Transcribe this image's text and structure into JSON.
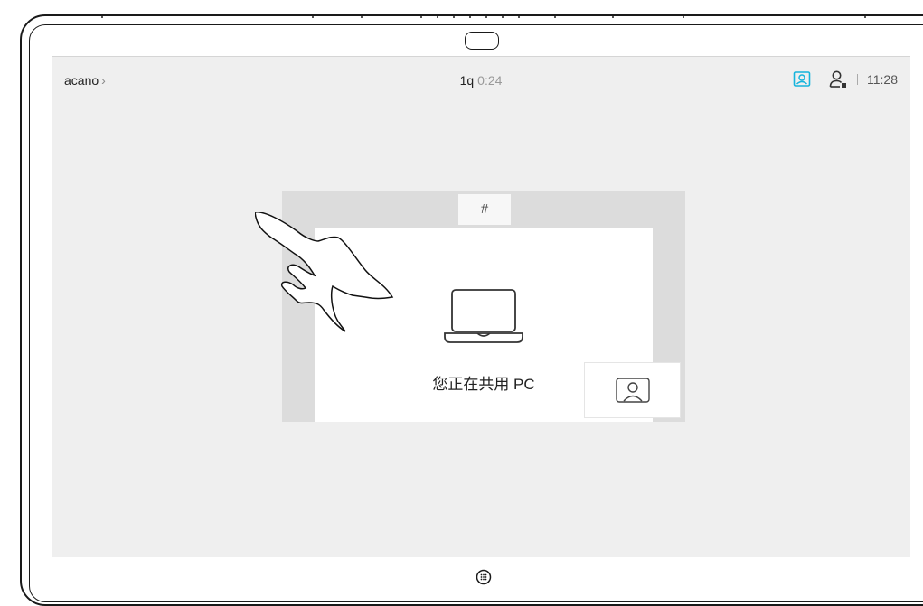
{
  "status_bar": {
    "caller_name": "acano",
    "caller_chevron": "›",
    "call_label": "1q",
    "call_timer": "0:24",
    "time": "11:28"
  },
  "content": {
    "share_tag": "#",
    "share_message": "您正在共用 PC"
  },
  "controls": [
    {
      "name": "camera-off",
      "icon": "camera-off-icon",
      "color": "#3c3c3c"
    },
    {
      "name": "add-participant",
      "icon": "plus-icon",
      "color": "#3c3c3c"
    },
    {
      "name": "share-screen",
      "icon": "share-icon",
      "color": "#16b4dc"
    },
    {
      "name": "hold",
      "icon": "pause-icon",
      "color": "#3c3c3c"
    },
    {
      "name": "keypad",
      "icon": "keypad-icon",
      "color": "#3c3c3c"
    },
    {
      "name": "transfer",
      "icon": "arrow-right-icon",
      "color": "#3c3c3c"
    },
    {
      "name": "end-call",
      "icon": "close-icon",
      "color": "#f44b3c"
    }
  ],
  "colors": {
    "accent": "#16b4dc",
    "end_call": "#f44b3c",
    "screen_bg": "#efefef",
    "button_dark": "#3c3c3c"
  }
}
